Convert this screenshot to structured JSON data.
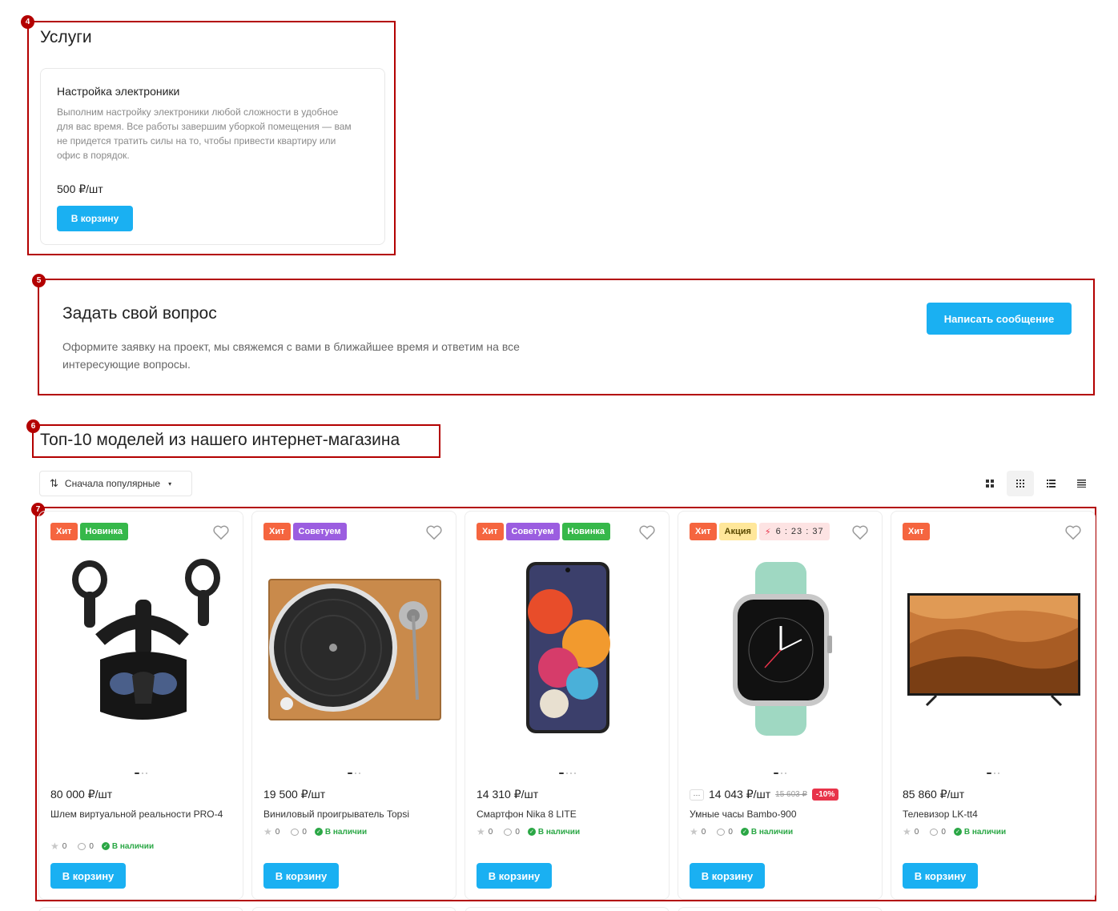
{
  "annotations": [
    "4",
    "5",
    "6",
    "7"
  ],
  "services": {
    "title": "Услуги",
    "card": {
      "name": "Настройка электроники",
      "description": "Выполним настройку электроники любой сложности в удобное для вас время. Все работы завершим уборкой помещения — вам не придется тратить силы на то, чтобы привести квартиру или офис в порядок.",
      "price": "500 ₽/шт",
      "button": "В корзину"
    }
  },
  "ask": {
    "title": "Задать свой вопрос",
    "description": "Оформите заявку на проект, мы свяжемся с вами в ближайшее время и ответим на все интересующие вопросы.",
    "button": "Написать сообщение"
  },
  "top": {
    "title": "Топ-10 моделей из нашего интернет-магазина",
    "sort_label": "Сначала популярные"
  },
  "colors": {
    "accent": "#1ab0f2",
    "annotation": "#b30000",
    "hit": "#f5653f",
    "new": "#36b84a",
    "recommend": "#9b5de0",
    "sale": "#ffe79a",
    "discount": "#e8334a",
    "stock": "#2aa745"
  },
  "products": [
    {
      "badges": [
        "Хит",
        "Новинка"
      ],
      "price": "80 000 ₽/шт",
      "name": "Шлем виртуальной реальности PRO-4",
      "rating": "0",
      "comments": "0",
      "stock": "В наличии",
      "button": "В корзину"
    },
    {
      "badges": [
        "Хит",
        "Советуем"
      ],
      "price": "19 500 ₽/шт",
      "name": "Виниловый проигрыватель Topsi",
      "rating": "0",
      "comments": "0",
      "stock": "В наличии",
      "button": "В корзину"
    },
    {
      "badges": [
        "Хит",
        "Советуем",
        "Новинка"
      ],
      "price": "14 310 ₽/шт",
      "name": "Смартфон Nika 8 LITE",
      "rating": "0",
      "comments": "0",
      "stock": "В наличии",
      "button": "В корзину"
    },
    {
      "badges": [
        "Хит",
        "Акция"
      ],
      "timer": "6 : 23 : 37",
      "more": "···",
      "price": "14 043 ₽/шт",
      "old_price": "15 603 ₽",
      "discount": "-10%",
      "name": "Умные часы Bambo-900",
      "rating": "0",
      "comments": "0",
      "stock": "В наличии",
      "button": "В корзину"
    },
    {
      "badges": [
        "Хит"
      ],
      "price": "85 860 ₽/шт",
      "name": "Телевизор LK-tt4",
      "rating": "0",
      "comments": "0",
      "stock": "В наличии",
      "button": "В корзину"
    }
  ]
}
